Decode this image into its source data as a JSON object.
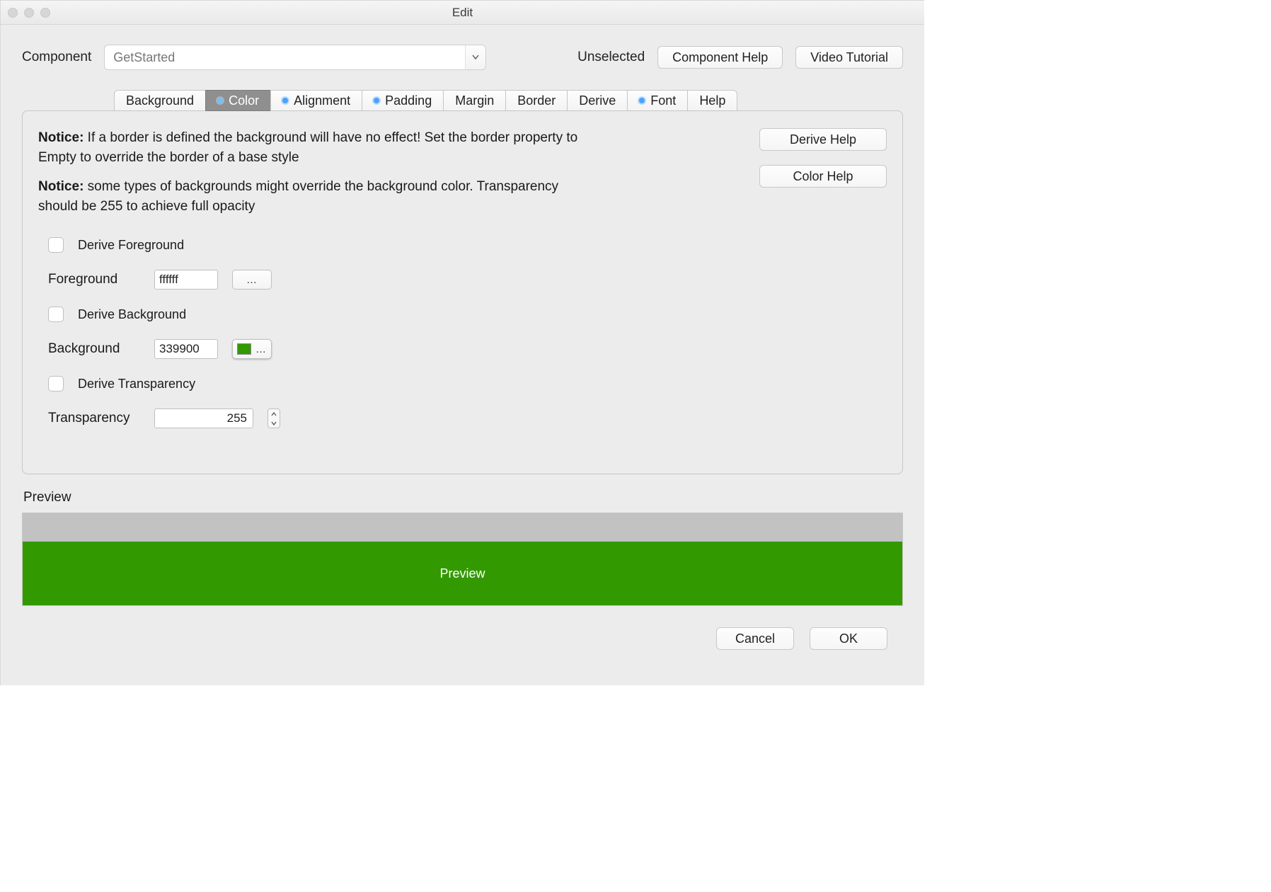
{
  "window": {
    "title": "Edit"
  },
  "top": {
    "component_label": "Component",
    "component_value": "GetStarted",
    "unselected_label": "Unselected",
    "component_help_btn": "Component Help",
    "video_tutorial_btn": "Video Tutorial"
  },
  "tabs": {
    "items": [
      {
        "label": "Background",
        "dot": false,
        "selected": false
      },
      {
        "label": "Color",
        "dot": true,
        "selected": true
      },
      {
        "label": "Alignment",
        "dot": true,
        "selected": false
      },
      {
        "label": "Padding",
        "dot": true,
        "selected": false
      },
      {
        "label": "Margin",
        "dot": false,
        "selected": false
      },
      {
        "label": "Border",
        "dot": false,
        "selected": false
      },
      {
        "label": "Derive",
        "dot": false,
        "selected": false
      },
      {
        "label": "Font",
        "dot": true,
        "selected": false
      },
      {
        "label": "Help",
        "dot": false,
        "selected": false
      }
    ]
  },
  "panel": {
    "notice1_prefix": "Notice:",
    "notice1_text": " If a border is defined the background will have no effect! Set the border property to Empty to override the border of a base style",
    "notice2_prefix": "Notice:",
    "notice2_text": " some types of backgrounds might override the background color. Transparency should be 255 to achieve full opacity",
    "derive_help_btn": "Derive Help",
    "color_help_btn": "Color Help"
  },
  "form": {
    "derive_foreground_label": "Derive Foreground",
    "foreground_label": "Foreground",
    "foreground_value": "ffffff",
    "foreground_swatch": "#ffffff",
    "derive_background_label": "Derive Background",
    "background_label": "Background",
    "background_value": "339900",
    "background_swatch": "#339900",
    "derive_transparency_label": "Derive Transparency",
    "transparency_label": "Transparency",
    "transparency_value": "255",
    "ellipsis": "…"
  },
  "preview": {
    "label": "Preview",
    "body_text": "Preview",
    "body_bg": "#339900",
    "body_fg": "#ffffff"
  },
  "footer": {
    "cancel": "Cancel",
    "ok": "OK"
  }
}
